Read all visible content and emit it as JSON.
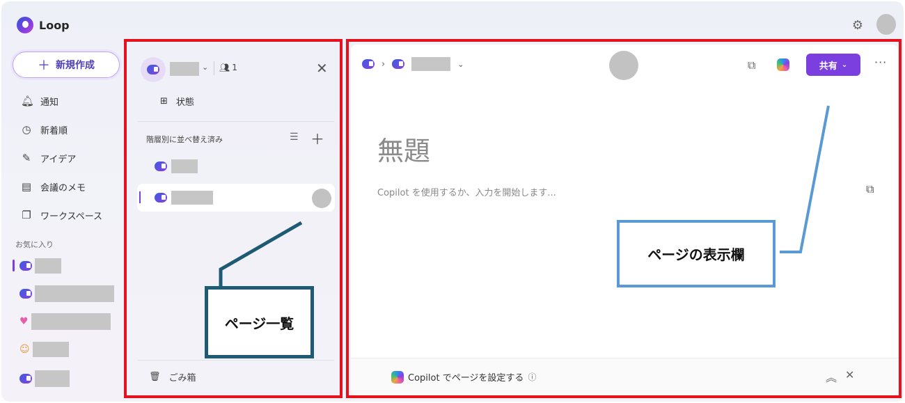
{
  "app": {
    "name": "Loop"
  },
  "sidebar": {
    "new_button": "新規作成",
    "items": [
      {
        "label": "通知",
        "icon": "bell-icon"
      },
      {
        "label": "新着順",
        "icon": "clock-icon"
      },
      {
        "label": "アイデア",
        "icon": "idea-icon"
      },
      {
        "label": "会議のメモ",
        "icon": "notes-icon"
      },
      {
        "label": "ワークスペース",
        "icon": "workspace-icon"
      }
    ],
    "favorites_label": "お気に入り"
  },
  "workspace_panel": {
    "member_count": "1",
    "status_label": "状態",
    "sort_label": "階層別に並べ替え済み",
    "trash_label": "ごみ箱"
  },
  "page": {
    "share_label": "共有",
    "title": "無題",
    "placeholder": "Copilot を使用するか、入力を開始します...",
    "copilot_setup": "Copilot でページを設定する"
  },
  "annotations": {
    "page_list": "ページ一覧",
    "page_view": "ページの表示欄"
  },
  "colors": {
    "accent": "#7b3fe0",
    "annotation_red": "#e3121c",
    "callout_dark": "#1e5a73",
    "callout_blue": "#5a9ad4"
  }
}
